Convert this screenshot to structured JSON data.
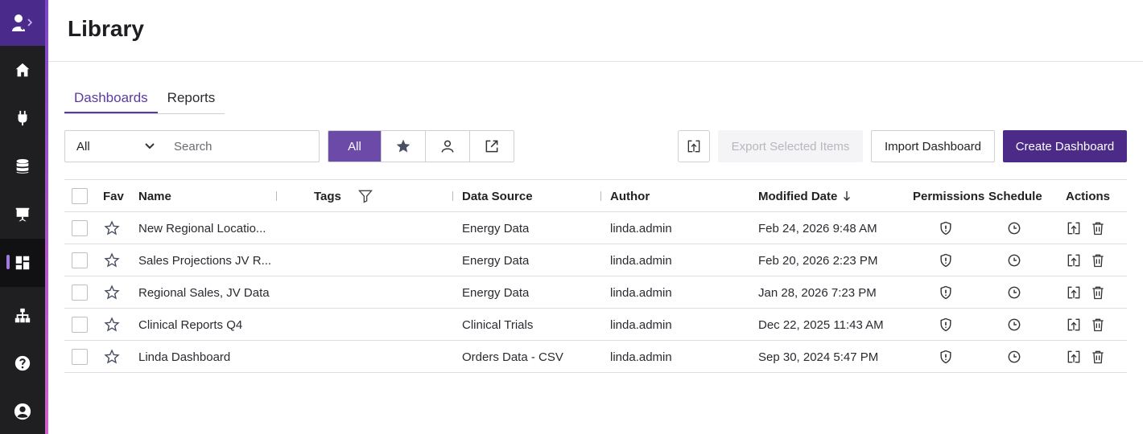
{
  "sidebar": {
    "items": [
      {
        "name": "home-icon"
      },
      {
        "name": "plug-icon"
      },
      {
        "name": "database-icon"
      },
      {
        "name": "presentation-icon"
      },
      {
        "name": "dashboard-icon",
        "active": true
      },
      {
        "name": "hierarchy-icon"
      },
      {
        "name": "help-icon"
      },
      {
        "name": "account-icon"
      }
    ]
  },
  "header": {
    "title": "Library"
  },
  "tabs": [
    {
      "label": "Dashboards",
      "active": true
    },
    {
      "label": "Reports",
      "active": false
    }
  ],
  "toolbar": {
    "filter_value": "All",
    "search_placeholder": "Search",
    "segments": {
      "all_label": "All"
    },
    "export_label": "Export Selected Items",
    "import_label": "Import Dashboard",
    "create_label": "Create Dashboard"
  },
  "table": {
    "columns": {
      "fav": "Fav",
      "name": "Name",
      "tags": "Tags",
      "data_source": "Data Source",
      "author": "Author",
      "modified": "Modified Date",
      "permissions": "Permissions",
      "schedule": "Schedule",
      "actions": "Actions"
    },
    "rows": [
      {
        "name": "New Regional Locatio...",
        "data_source": "Energy Data",
        "author": "linda.admin",
        "modified": "Feb 24, 2026 9:48 AM"
      },
      {
        "name": "Sales Projections JV R...",
        "data_source": "Energy Data",
        "author": "linda.admin",
        "modified": "Feb 20, 2026 2:23 PM"
      },
      {
        "name": "Regional Sales, JV Data",
        "data_source": "Energy Data",
        "author": "linda.admin",
        "modified": "Jan 28, 2026 7:23 PM"
      },
      {
        "name": "Clinical Reports Q4",
        "data_source": "Clinical Trials",
        "author": "linda.admin",
        "modified": "Dec 22, 2025 11:43 AM"
      },
      {
        "name": "Linda Dashboard",
        "data_source": "Orders Data - CSV",
        "author": "linda.admin",
        "modified": "Sep 30, 2024 5:47 PM"
      }
    ]
  },
  "colors": {
    "accent": "#5b3aa3",
    "primary_button": "#4b2a88",
    "sidebar": "#1f1f22"
  }
}
